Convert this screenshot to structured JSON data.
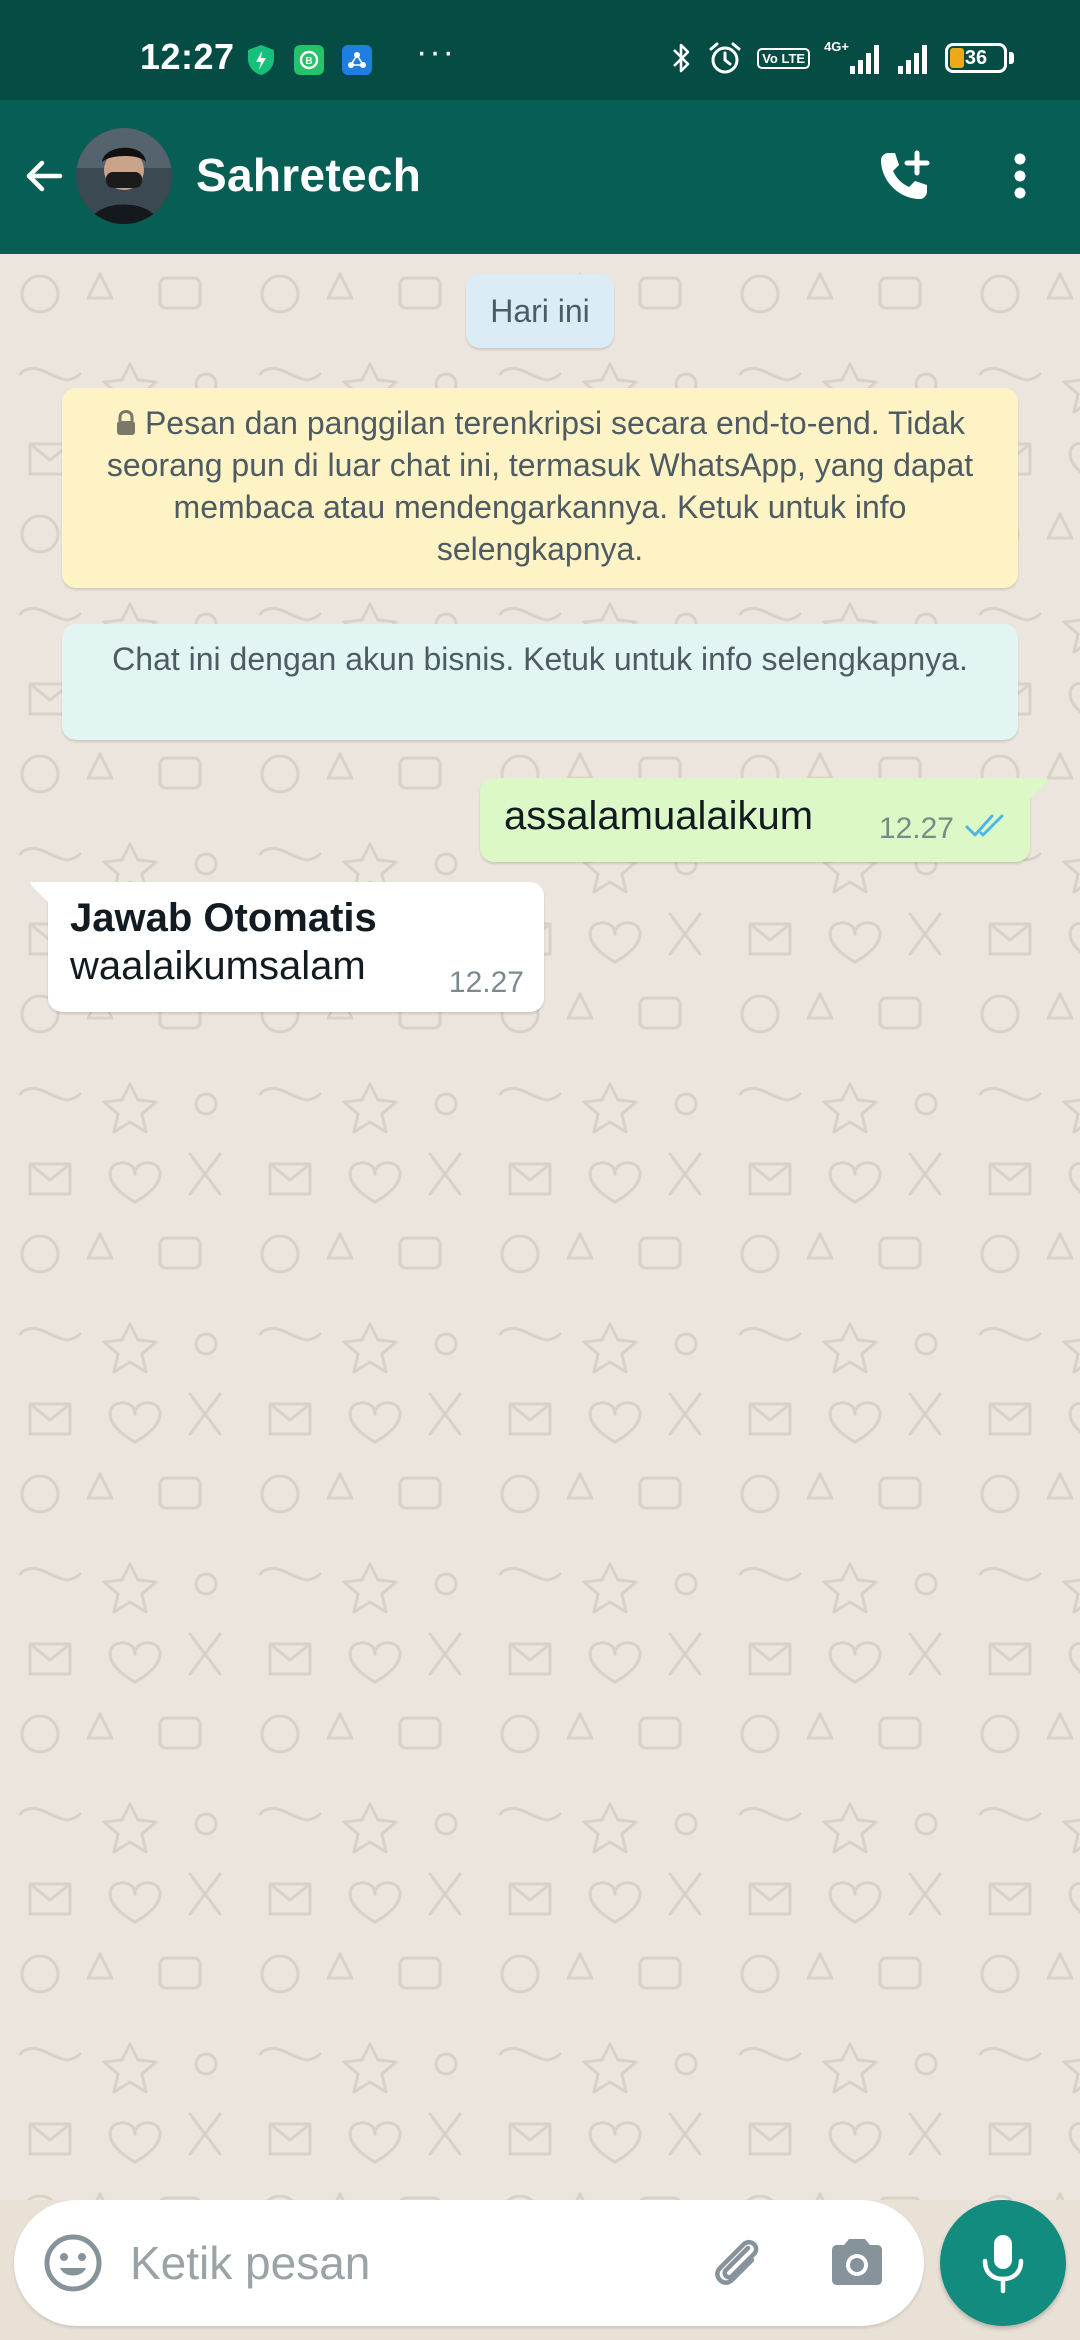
{
  "status_bar": {
    "time": "12:27",
    "network_label": "4G+",
    "volte_label": "Vo LTE",
    "battery_level": "36",
    "overflow": "···",
    "icons": [
      "shield-bolt-icon",
      "whatsapp-business-icon",
      "sync-app-icon",
      "bluetooth-icon",
      "alarm-icon",
      "signal-icon",
      "signal-icon",
      "battery-icon"
    ]
  },
  "app_bar": {
    "contact_name": "Sahretech",
    "icons": [
      "back-arrow-icon",
      "add-call-icon",
      "more-vert-icon"
    ]
  },
  "chat": {
    "date_chip": "Hari ini",
    "encryption_notice": "Pesan dan panggilan terenkripsi secara end-to-end. Tidak seorang pun di luar chat ini, termasuk WhatsApp, yang dapat membaca atau mendengarkannya. Ketuk untuk info selengkapnya.",
    "business_notice": "Chat ini dengan akun bisnis. Ketuk untuk info selengkapnya.",
    "messages": [
      {
        "direction": "outgoing",
        "text": "assalamualaikum",
        "time": "12.27",
        "status": "read"
      },
      {
        "direction": "incoming",
        "title": "Jawab Otomatis",
        "text": "waalaikumsalam",
        "time": "12.27"
      }
    ]
  },
  "composer": {
    "placeholder": "Ketik pesan",
    "value": ""
  },
  "colors": {
    "header": "#075e54",
    "status_bar": "#054d44",
    "outgoing_bubble": "#dcf8c6",
    "incoming_bubble": "#ffffff",
    "read_ticks": "#4fb6ec",
    "mic_button": "#128c7e",
    "encryption_notice_bg": "#fdf3c4",
    "business_notice_bg": "#e2f5f2",
    "date_chip_bg": "#dcecf6"
  }
}
